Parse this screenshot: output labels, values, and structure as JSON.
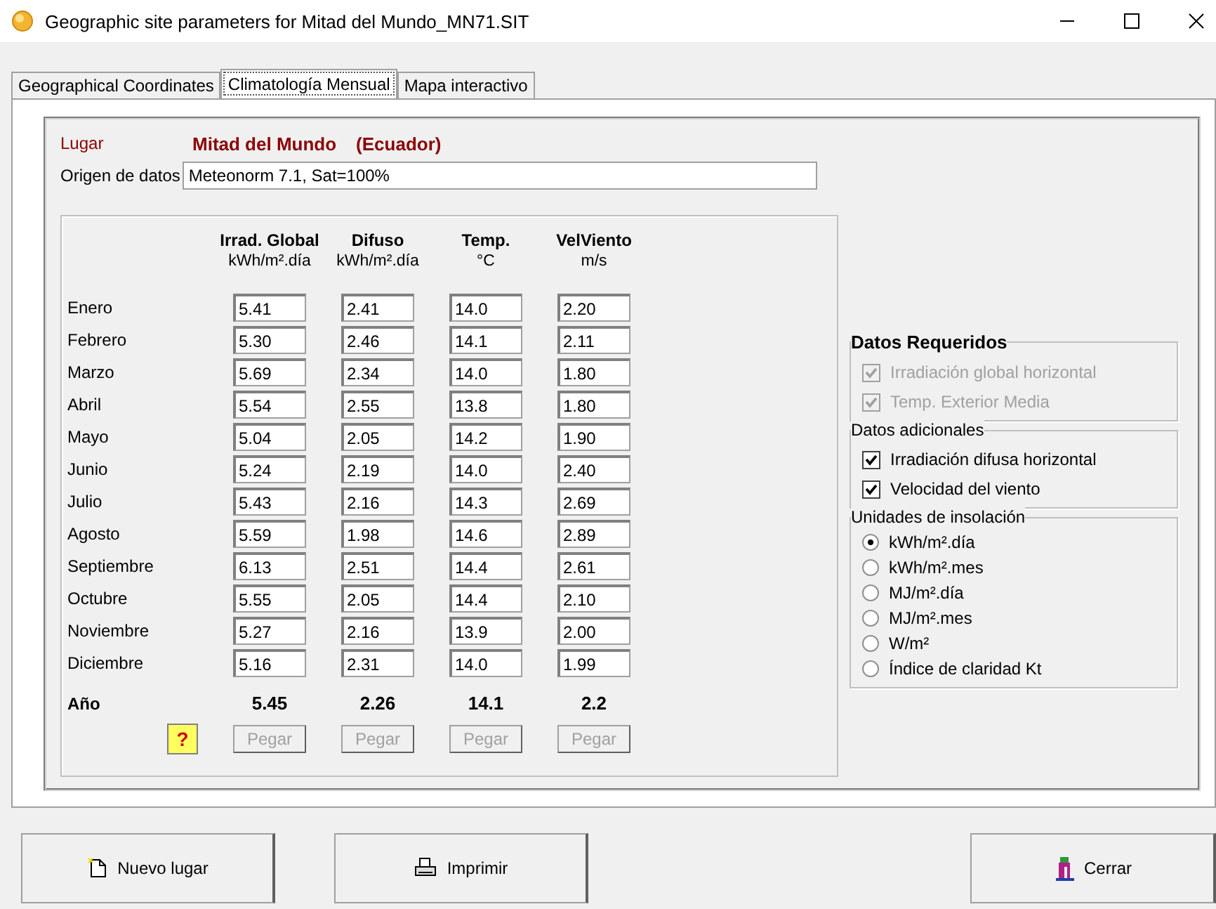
{
  "window": {
    "title": "Geographic site parameters for Mitad del Mundo_MN71.SIT"
  },
  "tabs": [
    {
      "label": "Geographical Coordinates",
      "selected": false
    },
    {
      "label": "Climatología Mensual",
      "selected": true
    },
    {
      "label": "Mapa interactivo",
      "selected": false
    }
  ],
  "location": {
    "label": "Lugar",
    "name": "Mitad del Mundo",
    "country": "(Ecuador)"
  },
  "source": {
    "label": "Origen de datos",
    "value": "Meteonorm 7.1, Sat=100%"
  },
  "table": {
    "columns": [
      {
        "name": "Irrad. Global",
        "unit": "kWh/m².día"
      },
      {
        "name": "Difuso",
        "unit": "kWh/m².día"
      },
      {
        "name": "Temp.",
        "unit": "°C"
      },
      {
        "name": "VelViento",
        "unit": "m/s"
      }
    ],
    "rows": [
      {
        "month": "Enero",
        "values": [
          "5.41",
          "2.41",
          "14.0",
          "2.20"
        ]
      },
      {
        "month": "Febrero",
        "values": [
          "5.30",
          "2.46",
          "14.1",
          "2.11"
        ]
      },
      {
        "month": "Marzo",
        "values": [
          "5.69",
          "2.34",
          "14.0",
          "1.80"
        ]
      },
      {
        "month": "Abril",
        "values": [
          "5.54",
          "2.55",
          "13.8",
          "1.80"
        ]
      },
      {
        "month": "Mayo",
        "values": [
          "5.04",
          "2.05",
          "14.2",
          "1.90"
        ]
      },
      {
        "month": "Junio",
        "values": [
          "5.24",
          "2.19",
          "14.0",
          "2.40"
        ]
      },
      {
        "month": "Julio",
        "values": [
          "5.43",
          "2.16",
          "14.3",
          "2.69"
        ]
      },
      {
        "month": "Agosto",
        "values": [
          "5.59",
          "1.98",
          "14.6",
          "2.89"
        ]
      },
      {
        "month": "Septiembre",
        "values": [
          "6.13",
          "2.51",
          "14.4",
          "2.61"
        ]
      },
      {
        "month": "Octubre",
        "values": [
          "5.55",
          "2.05",
          "14.4",
          "2.10"
        ]
      },
      {
        "month": "Noviembre",
        "values": [
          "5.27",
          "2.16",
          "13.9",
          "2.00"
        ]
      },
      {
        "month": "Diciembre",
        "values": [
          "5.16",
          "2.31",
          "14.0",
          "1.99"
        ]
      }
    ],
    "total": {
      "label": "Año",
      "values": [
        "5.45",
        "2.26",
        "14.1",
        "2.2"
      ]
    }
  },
  "help_button": {
    "label": "?"
  },
  "paste_buttons": [
    {
      "label": "Pegar",
      "disabled": true
    },
    {
      "label": "Pegar",
      "disabled": true
    },
    {
      "label": "Pegar",
      "disabled": true
    },
    {
      "label": "Pegar",
      "disabled": true
    }
  ],
  "required": {
    "title": "Datos Requeridos",
    "items": [
      {
        "label": "Irradiación global horizontal",
        "checked": true,
        "disabled": true
      },
      {
        "label": "Temp. Exterior Media",
        "checked": true,
        "disabled": true
      }
    ]
  },
  "additional": {
    "title": "Datos adicionales",
    "items": [
      {
        "label": "Irradiación difusa horizontal",
        "checked": true,
        "disabled": false
      },
      {
        "label": "Velocidad del viento",
        "checked": true,
        "disabled": false
      }
    ]
  },
  "units": {
    "title": "Unidades de insolación",
    "options": [
      {
        "label": "kWh/m².día",
        "selected": true
      },
      {
        "label": "kWh/m².mes",
        "selected": false
      },
      {
        "label": "MJ/m².día",
        "selected": false
      },
      {
        "label": "MJ/m².mes",
        "selected": false
      },
      {
        "label": "W/m²",
        "selected": false
      },
      {
        "label": "Índice de claridad Kt",
        "selected": false
      }
    ]
  },
  "buttons": [
    {
      "label": "Nuevo lugar",
      "kind": "new"
    },
    {
      "label": "Imprimir",
      "kind": "print"
    },
    {
      "label": "Cerrar",
      "kind": "close"
    }
  ]
}
